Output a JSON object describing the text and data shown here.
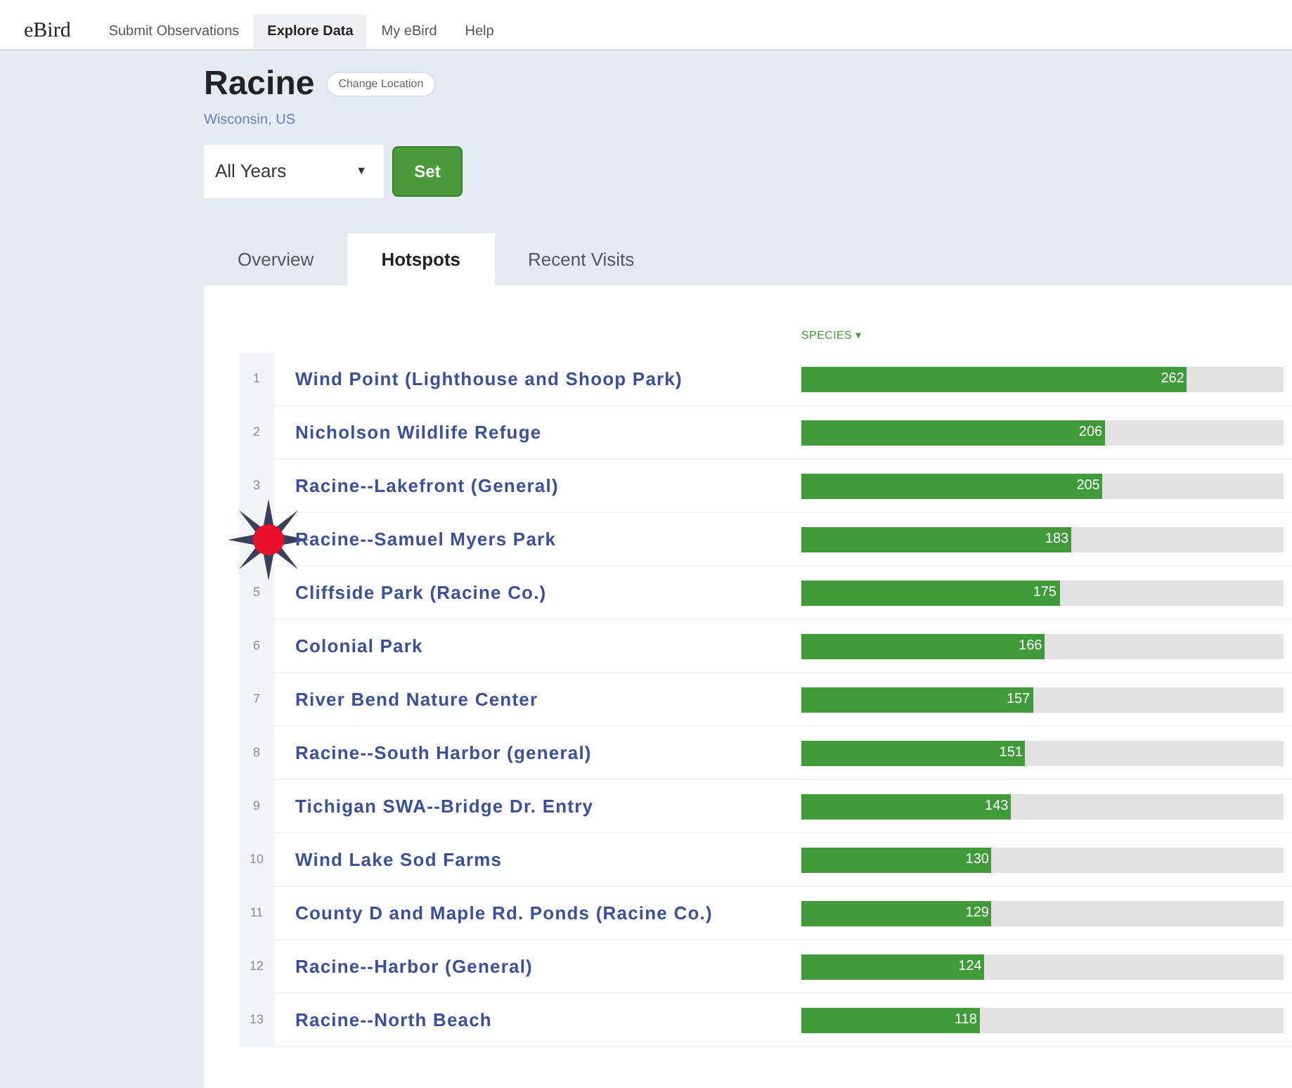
{
  "nav": {
    "logo": "eBird",
    "items": [
      {
        "label": "Submit Observations",
        "selected": false
      },
      {
        "label": "Explore Data",
        "selected": true
      },
      {
        "label": "My eBird",
        "selected": false
      },
      {
        "label": "Help",
        "selected": false
      }
    ]
  },
  "location": {
    "title": "Racine",
    "change_button": "Change Location",
    "region": "Wisconsin, US"
  },
  "year_select": {
    "value": "All Years",
    "arrow": "▼",
    "button": "Set"
  },
  "tabs": [
    {
      "label": "Overview",
      "selected": false
    },
    {
      "label": "Hotspots",
      "selected": true
    },
    {
      "label": "Recent Visits",
      "selected": false
    }
  ],
  "table": {
    "column_header": "SPECIES",
    "sort_arrow": "▾",
    "rows": [
      {
        "rank": "1",
        "name": "Wind Point (Lighthouse and Shoop Park)",
        "species": "262",
        "level": 0.8
      },
      {
        "rank": "2",
        "name": "Nicholson Wildlife Refuge",
        "species": "206",
        "level": 0.63
      },
      {
        "rank": "3",
        "name": "Racine--Lakefront (General)",
        "species": "205",
        "level": 0.625
      },
      {
        "name": "Racine--Samuel Myers Park",
        "species": "183",
        "level": 0.56,
        "marked": true
      },
      {
        "rank": "5",
        "name": "Cliffside Park (Racine Co.)",
        "species": "175",
        "level": 0.535
      },
      {
        "rank": "6",
        "name": "Colonial Park",
        "species": "166",
        "level": 0.505
      },
      {
        "rank": "7",
        "name": "River Bend Nature Center",
        "species": "157",
        "level": 0.48
      },
      {
        "rank": "8",
        "name": "Racine--South Harbor (general)",
        "species": "151",
        "level": 0.465
      },
      {
        "rank": "9",
        "name": "Tichigan SWA--Bridge Dr. Entry",
        "species": "143",
        "level": 0.435
      },
      {
        "rank": "10",
        "name": "Wind Lake Sod Farms",
        "species": "130",
        "level": 0.395
      },
      {
        "rank": "11",
        "name": "County D and Maple Rd. Ponds (Racine Co.)",
        "species": "129",
        "level": 0.395
      },
      {
        "rank": "12",
        "name": "Racine--Harbor (General)",
        "species": "124",
        "level": 0.38
      },
      {
        "rank": "13",
        "name": "Racine--North Beach",
        "species": "118",
        "level": 0.37
      }
    ]
  }
}
